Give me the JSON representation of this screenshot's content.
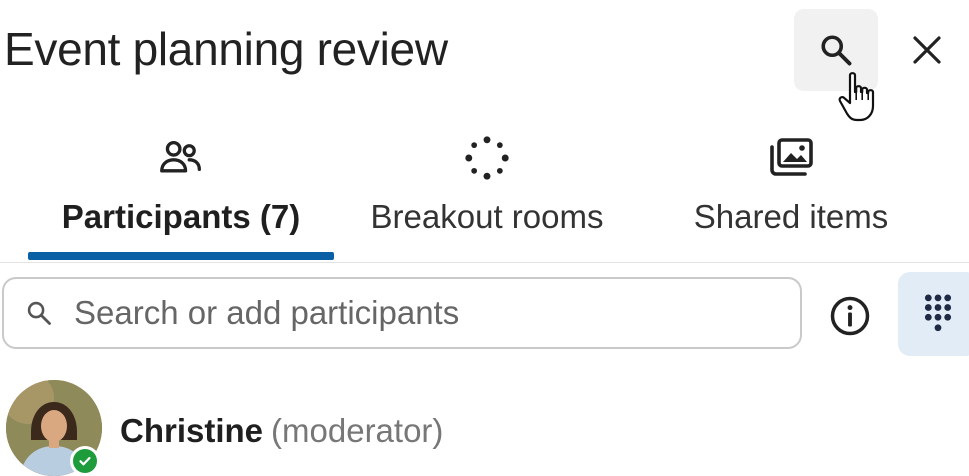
{
  "header": {
    "title": "Event planning review",
    "search_icon": "search-icon",
    "close_icon": "close-icon"
  },
  "tabs": [
    {
      "label": "Participants (7)",
      "icon": "people-icon",
      "active": true
    },
    {
      "label": "Breakout rooms",
      "icon": "breakout-rooms-icon",
      "active": false
    },
    {
      "label": "Shared items",
      "icon": "shared-items-icon",
      "active": false
    }
  ],
  "search": {
    "placeholder": "Search or add participants",
    "value": ""
  },
  "toolbar": {
    "info_icon": "info-icon",
    "dialpad_icon": "dialpad-icon"
  },
  "participants": [
    {
      "name": "Christine",
      "role": "(moderator)",
      "status": "available"
    }
  ],
  "colors": {
    "accent": "#0b5fa5",
    "presence_available": "#1e9b3b",
    "dialpad_bg": "#e2ecf6",
    "search_button_bg": "#f1f1f1"
  }
}
